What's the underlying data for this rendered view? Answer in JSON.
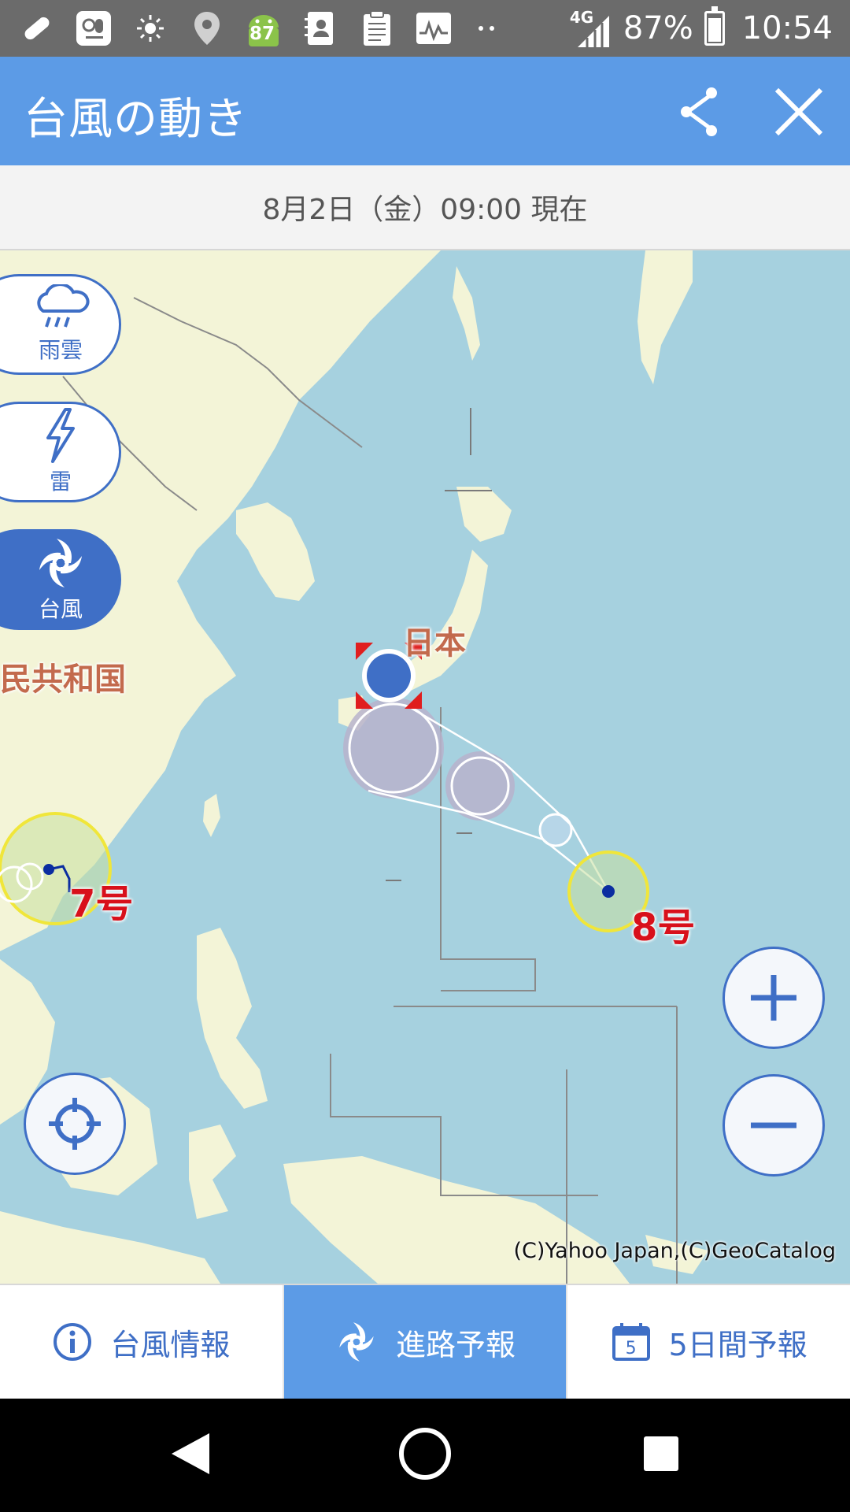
{
  "status_bar": {
    "notification_icons": [
      "bandage-icon",
      "voicemail-icon",
      "brightness-icon",
      "location-icon",
      "android-icon",
      "contacts-icon",
      "clipboard-icon",
      "activity-icon",
      "more-dots-icon"
    ],
    "android_badge": "87",
    "network": "4G",
    "battery": "87%",
    "time": "10:54"
  },
  "app_bar": {
    "title": "台風の動き"
  },
  "date_bar": {
    "text": "8月2日（金）09:00 現在"
  },
  "layers": [
    {
      "label": "雨雲",
      "icon": "rain-cloud-icon",
      "active": false
    },
    {
      "label": "雷",
      "icon": "lightning-icon",
      "active": false
    },
    {
      "label": "台風",
      "icon": "typhoon-icon",
      "active": true
    }
  ],
  "map": {
    "country_labels": {
      "japan": "日本",
      "china": "民共和国"
    },
    "typhoons": [
      {
        "label": "7号"
      },
      {
        "label": "8号"
      }
    ],
    "copyright": "(C)Yahoo Japan,(C)GeoCatalog"
  },
  "tabs": [
    {
      "label": "台風情報",
      "icon": "info-icon",
      "active": false
    },
    {
      "label": "進路予報",
      "icon": "typhoon-icon",
      "active": true
    },
    {
      "label": "5日間予報",
      "icon": "calendar-icon",
      "calendar_day": "5",
      "active": false
    }
  ],
  "colors": {
    "app_bar": "#5c9be6",
    "accent": "#3f6fc6",
    "sea": "#a6d1df",
    "land": "#f3f4d7",
    "typhoon_label": "#d8101b"
  }
}
